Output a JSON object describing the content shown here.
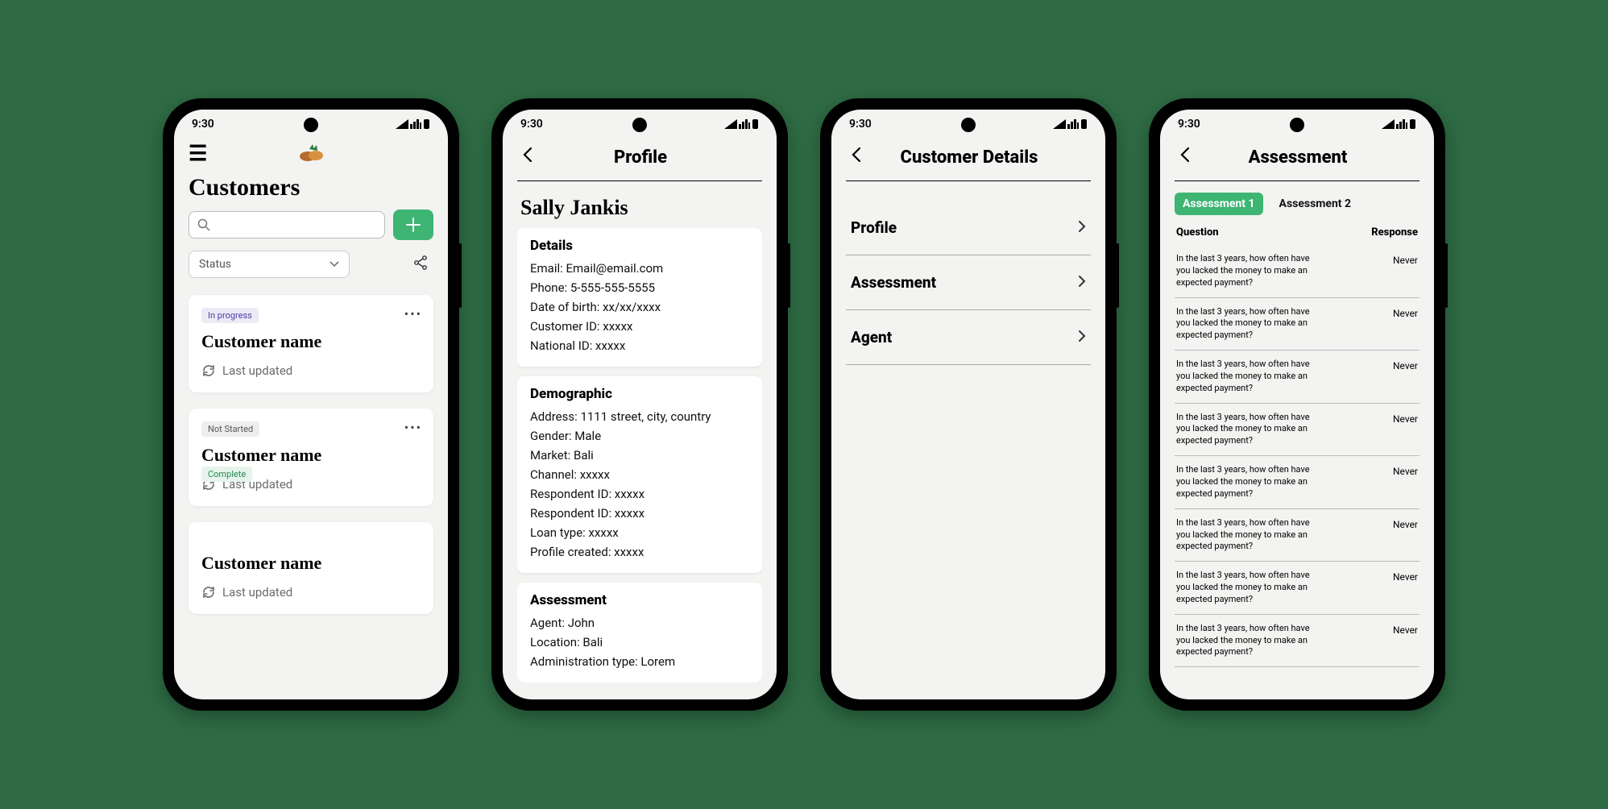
{
  "status_time": "9:30",
  "screen1": {
    "title": "Customers",
    "status_filter_label": "Status",
    "cards": [
      {
        "badge": "In progress",
        "badge_cls": "progress",
        "name": "Customer name",
        "updated": "Last updated",
        "extra_badge": null
      },
      {
        "badge": "Not Started",
        "badge_cls": "notstarted",
        "name": "Customer name",
        "updated": "Last updated",
        "extra_badge": "Complete"
      },
      {
        "badge": null,
        "badge_cls": "",
        "name": "Customer name",
        "updated": "Last updated",
        "extra_badge": null
      }
    ]
  },
  "screen2": {
    "title": "Profile",
    "name": "Sally Jankis",
    "sections": [
      {
        "heading": "Details",
        "rows": [
          "Email: Email@email.com",
          "Phone: 5-555-555-5555",
          "Date of birth: xx/xx/xxxx",
          "Customer ID: xxxxx",
          "National ID: xxxxx"
        ]
      },
      {
        "heading": "Demographic",
        "rows": [
          "Address: 1111 street, city, country",
          "Gender: Male",
          "Market: Bali",
          "Channel: xxxxx",
          "Respondent ID: xxxxx",
          "Respondent ID: xxxxx",
          "Loan type: xxxxx",
          "Profile created: xxxxx"
        ]
      },
      {
        "heading": "Assessment",
        "rows": [
          "Agent: John",
          "Location: Bali",
          "Administration type: Lorem"
        ]
      }
    ]
  },
  "screen3": {
    "title": "Customer Details",
    "items": [
      "Profile",
      "Assessment",
      "Agent"
    ]
  },
  "screen4": {
    "title": "Assessment",
    "tabs": [
      "Assessment 1",
      "Assessment 2"
    ],
    "active_tab": 0,
    "col_q": "Question",
    "col_r": "Response",
    "question": "In the last 3 years, how often have you lacked the money to make an expected payment?",
    "response": "Never",
    "row_count": 8
  }
}
